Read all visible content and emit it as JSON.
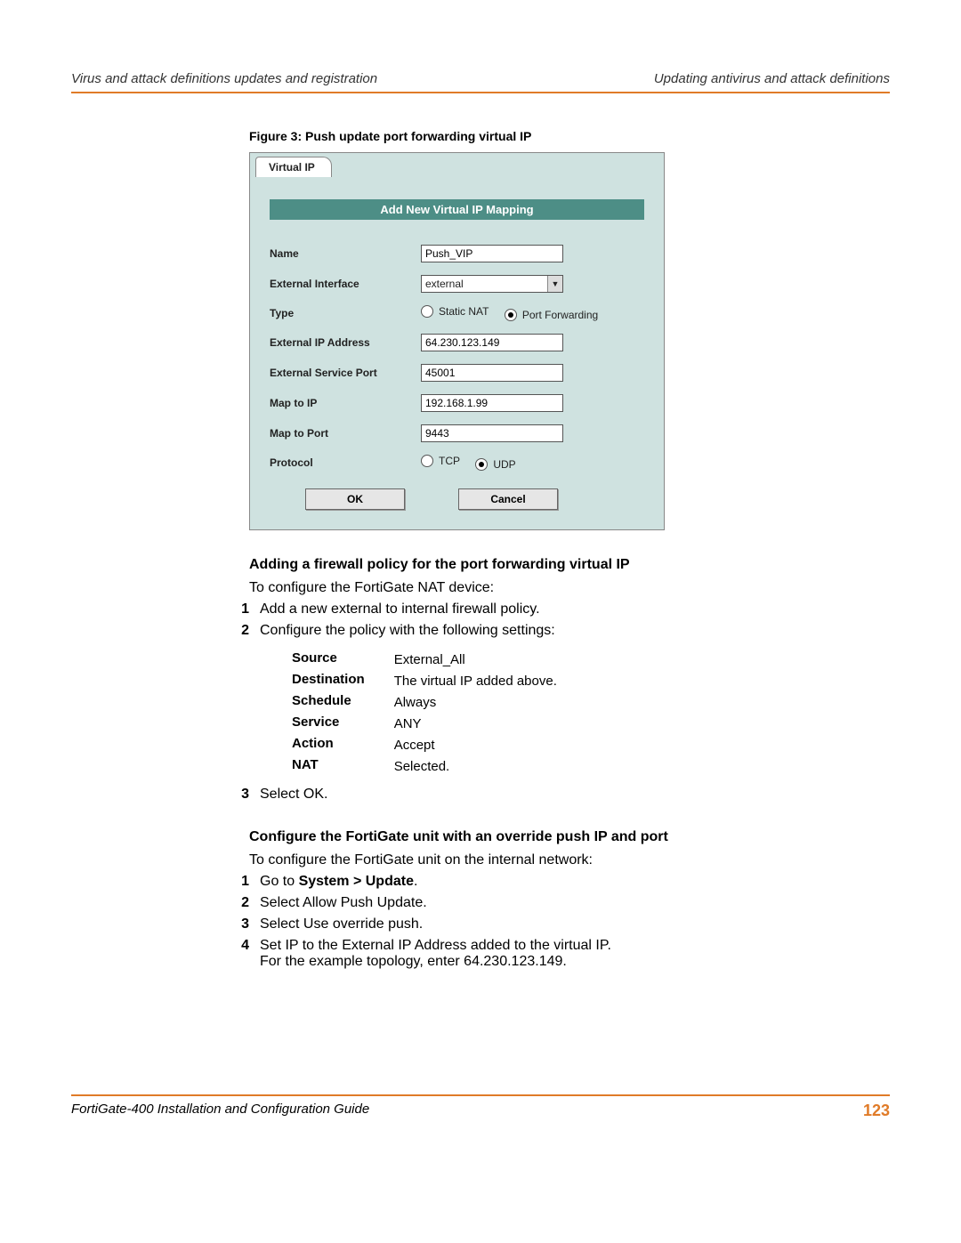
{
  "header": {
    "left": "Virus and attack definitions updates and registration",
    "right": "Updating antivirus and attack definitions"
  },
  "figure": {
    "caption": "Figure 3:   Push update port forwarding virtual IP",
    "tab": "Virtual IP",
    "panel_title": "Add New Virtual IP Mapping",
    "labels": {
      "name": "Name",
      "ext_if": "External Interface",
      "type": "Type",
      "ext_ip": "External IP Address",
      "ext_port": "External Service Port",
      "map_ip": "Map to IP",
      "map_port": "Map to Port",
      "protocol": "Protocol"
    },
    "values": {
      "name": "Push_VIP",
      "ext_if": "external",
      "ext_ip": "64.230.123.149",
      "ext_port": "45001",
      "map_ip": "192.168.1.99",
      "map_port": "9443"
    },
    "type_options": {
      "static": "Static NAT",
      "pf": "Port Forwarding"
    },
    "protocol_options": {
      "tcp": "TCP",
      "udp": "UDP"
    },
    "buttons": {
      "ok": "OK",
      "cancel": "Cancel"
    }
  },
  "section1": {
    "heading": "Adding a firewall policy for the port forwarding virtual IP",
    "intro": "To configure the FortiGate NAT device:",
    "step1": "Add a new external to internal firewall policy.",
    "step2": "Configure the policy with the following settings:",
    "settings": {
      "Source": "External_All",
      "Destination": "The virtual IP added above.",
      "Schedule": "Always",
      "Service": "ANY",
      "Action": "Accept",
      "NAT": "Selected."
    },
    "step3": "Select OK."
  },
  "section2": {
    "heading": "Configure the FortiGate unit with an override push IP and port",
    "intro": "To configure the FortiGate unit on the internal network:",
    "step1a": "Go to ",
    "step1b": "System > Update",
    "step1c": ".",
    "step2": "Select Allow Push Update.",
    "step3": "Select Use override push.",
    "step4a": "Set IP to the External IP Address added to the virtual IP.",
    "step4b": "For the example topology, enter 64.230.123.149."
  },
  "footer": {
    "left": "FortiGate-400 Installation and Configuration Guide",
    "page": "123"
  },
  "nums": {
    "n1": "1",
    "n2": "2",
    "n3": "3",
    "n4": "4"
  }
}
